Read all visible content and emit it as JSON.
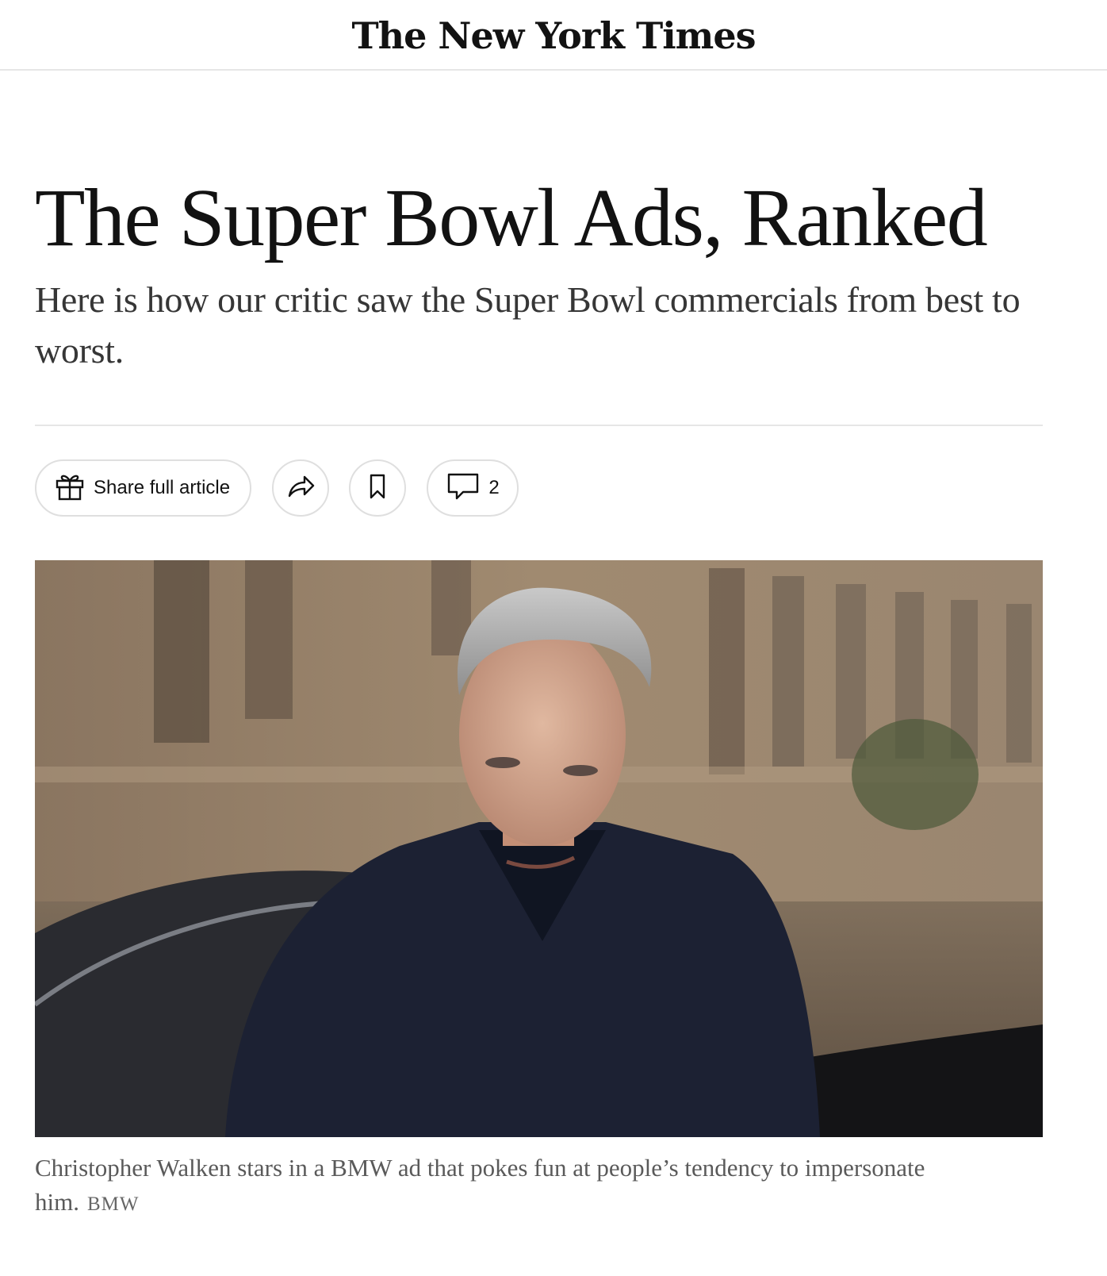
{
  "masthead": {
    "logo_text": "The New York Times"
  },
  "article": {
    "headline": "The Super Bowl Ads, Ranked",
    "summary": "Here is how our critic saw the Super Bowl commercials from best to worst."
  },
  "toolbar": {
    "share_full_label": "Share full article",
    "comment_count": "2",
    "icons": {
      "gift": "gift-icon",
      "share": "share-arrow-icon",
      "save": "bookmark-icon",
      "comments": "comment-bubble-icon"
    }
  },
  "media": {
    "caption": "Christopher Walken stars in a BMW ad that pokes fun at people’s tendency to impersonate him.",
    "credit": "BMW"
  },
  "colors": {
    "text": "#121212",
    "muted": "#5a5a5a",
    "rule": "#e6e6e6"
  }
}
